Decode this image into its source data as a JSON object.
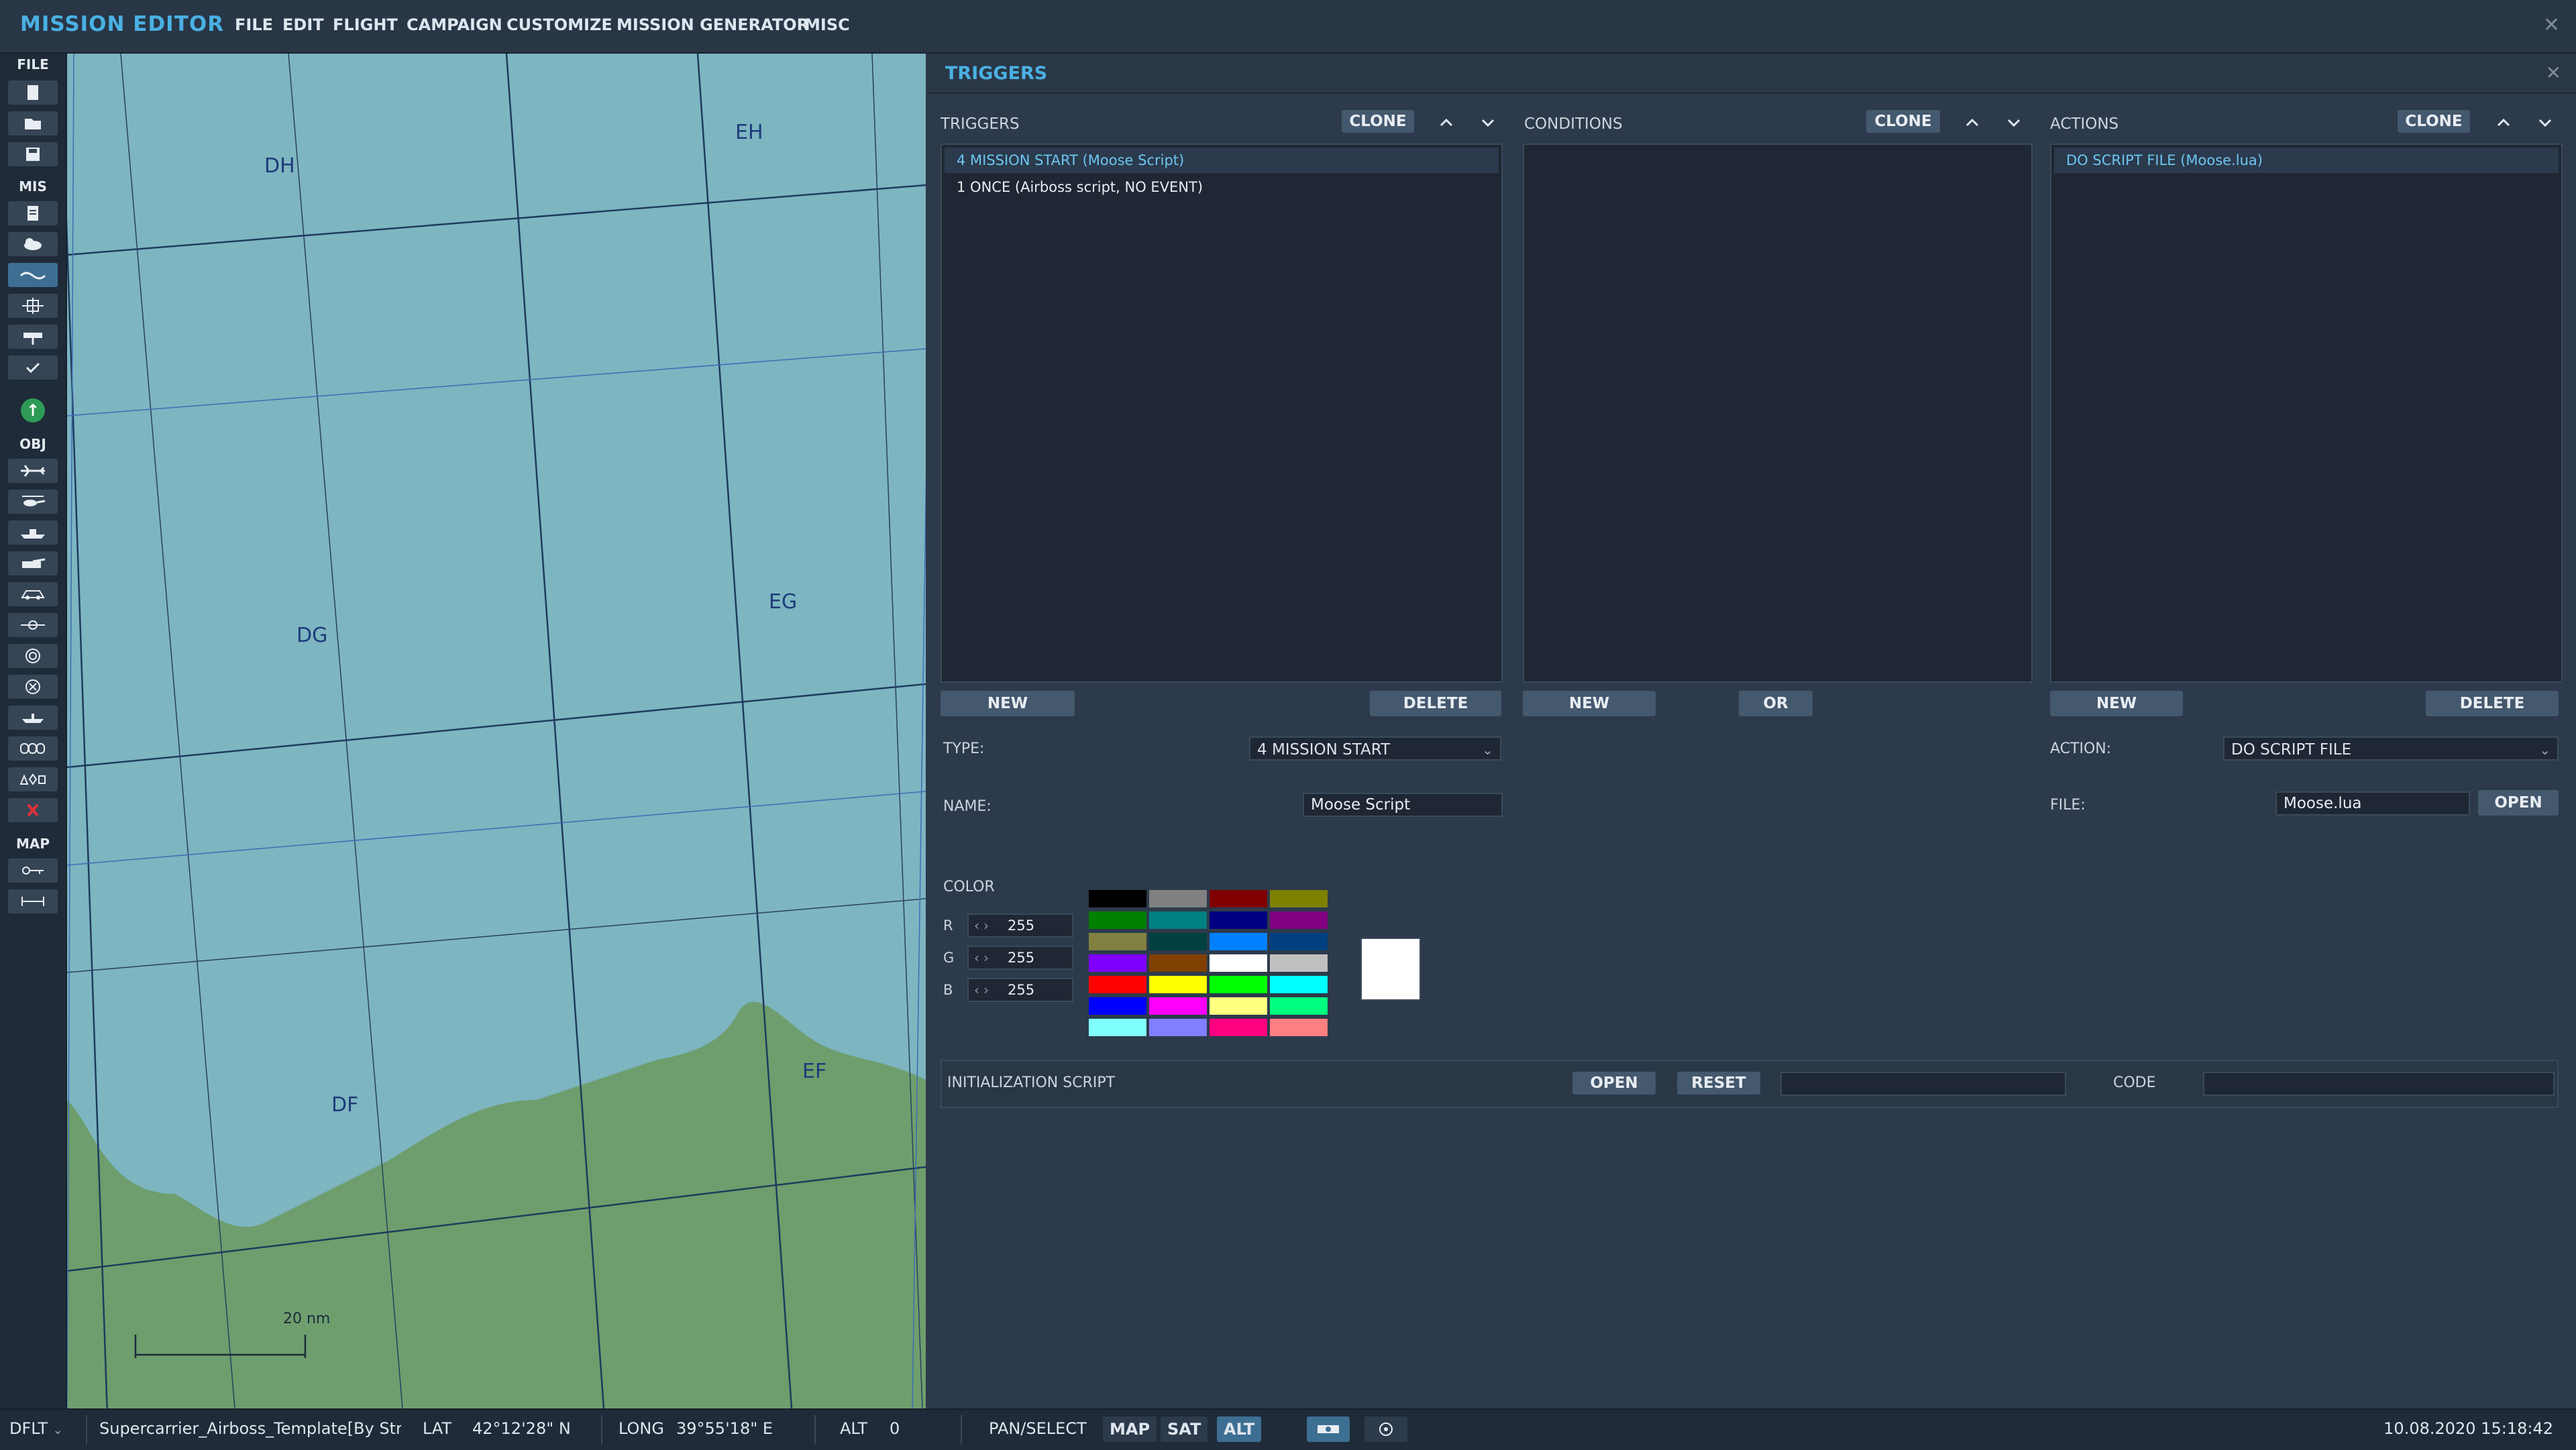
{
  "menubar": {
    "title": "MISSION EDITOR",
    "items": [
      "FILE",
      "EDIT",
      "FLIGHT",
      "CAMPAIGN",
      "CUSTOMIZE",
      "MISSION GENERATOR",
      "MISC"
    ],
    "close_icon": "close-icon"
  },
  "toolbar": {
    "sections": [
      "FILE",
      "MIS",
      "OBJ",
      "MAP"
    ],
    "file_icons": [
      "new-file-icon",
      "open-folder-icon",
      "save-icon"
    ],
    "mis_icons": [
      "briefing-icon",
      "weather-icon",
      "triggers-icon",
      "goals-icon",
      "flag-icon",
      "check-icon"
    ],
    "obj_icons": [
      "plane-icon",
      "helicopter-icon",
      "ship-icon",
      "vehicle-icon",
      "armor-group-icon",
      "static-object-icon",
      "target-icon",
      "zone-icon",
      "carrier-icon",
      "template-icon",
      "shapes-icon",
      "delete-icon"
    ],
    "map_icons": [
      "key-icon",
      "ruler-icon"
    ],
    "green_label": "↑"
  },
  "map": {
    "grid_labels": [
      "DH",
      "EH",
      "DG",
      "EG",
      "DF",
      "EF"
    ],
    "scale": "20 nm",
    "colors": {
      "sea": "#7db5c1",
      "land": "#6e9e6d"
    }
  },
  "panel": {
    "title": "TRIGGERS",
    "triggers": {
      "label": "TRIGGERS",
      "clone": "CLONE",
      "items": [
        "4 MISSION START (Moose Script)",
        "1 ONCE (Airboss script, NO EVENT)"
      ],
      "selected_index": 0,
      "new": "NEW",
      "delete": "DELETE",
      "type_label": "TYPE:",
      "type_value": "4 MISSION START",
      "name_label": "NAME:",
      "name_value": "Moose Script"
    },
    "conditions": {
      "label": "CONDITIONS",
      "clone": "CLONE",
      "new": "NEW",
      "or": "OR"
    },
    "actions": {
      "label": "ACTIONS",
      "clone": "CLONE",
      "items": [
        "DO SCRIPT FILE (Moose.lua)"
      ],
      "new": "NEW",
      "delete": "DELETE",
      "action_label": "ACTION:",
      "action_value": "DO SCRIPT FILE",
      "file_label": "FILE:",
      "file_value": "Moose.lua",
      "open": "OPEN"
    },
    "color": {
      "label": "COLOR",
      "r_label": "R",
      "g_label": "G",
      "b_label": "B",
      "r": "255",
      "g": "255",
      "b": "255",
      "preview": "#ffffff",
      "palette": [
        "#000000",
        "#808080",
        "#800000",
        "#808000",
        "#008000",
        "#008080",
        "#000080",
        "#800080",
        "#808040",
        "#004040",
        "#0080ff",
        "#004080",
        "#8000ff",
        "#804000",
        "#ffffff",
        "#c0c0c0",
        "#ff0000",
        "#ffff00",
        "#00ff00",
        "#00ffff",
        "#0000ff",
        "#ff00ff",
        "#ffff80",
        "#00ff80",
        "#80ffff",
        "#8080ff",
        "#ff0080",
        "#ff8080"
      ]
    },
    "init_script": {
      "label": "INITIALIZATION SCRIPT",
      "open": "OPEN",
      "reset": "RESET",
      "code_label": "CODE"
    }
  },
  "statusbar": {
    "profile": "DFLT",
    "mission": "Supercarrier_Airboss_Template[By Stri",
    "lat_label": "LAT",
    "lat": "42°12'28\" N",
    "long_label": "LONG",
    "long": "39°55'18\" E",
    "alt_label": "ALT",
    "alt": "0",
    "pan_select": "PAN/SELECT",
    "map_btn": "MAP",
    "sat_btn": "SAT",
    "alt_btn": "ALT",
    "datetime": "10.08.2020 15:18:42"
  }
}
